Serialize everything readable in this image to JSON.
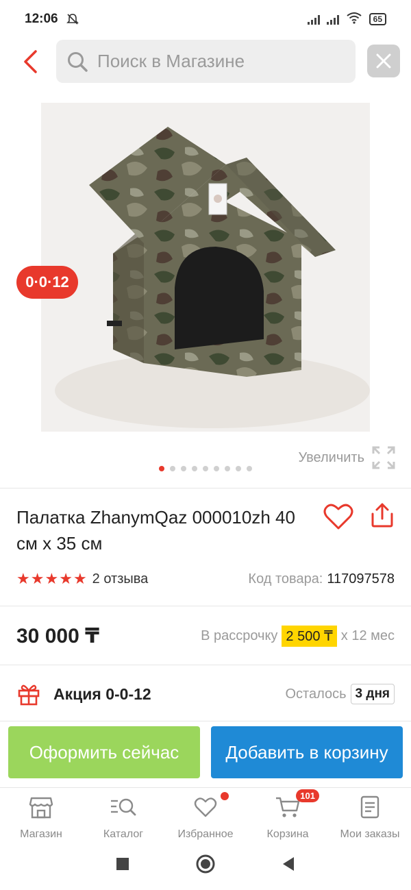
{
  "status_bar": {
    "time": "12:06",
    "battery": "65"
  },
  "search": {
    "placeholder": "Поиск в Магазине"
  },
  "gallery": {
    "promo_badge": "0·0·12",
    "zoom_label": "Увеличить",
    "dots_count": 9,
    "active_dot": 0
  },
  "product": {
    "title": "Палатка ZhanymQaz 000010zh 40 см х 35 см",
    "rating": 5,
    "reviews": "2 отзыва",
    "code_label": "Код товара:",
    "code_value": "117097578",
    "price": "30 000 ₸",
    "installment_label": "В рассрочку",
    "installment_amount": "2 500 ₸",
    "installment_term": "х 12 мес"
  },
  "promo": {
    "label": "Акция 0-0-12",
    "left_label": "Осталось",
    "days": "3 дня"
  },
  "actions": {
    "buy_now": "Оформить сейчас",
    "add_to_cart": "Добавить в корзину"
  },
  "bottom_nav": {
    "items": [
      {
        "label": "Магазин",
        "icon": "store-icon"
      },
      {
        "label": "Каталог",
        "icon": "catalog-icon"
      },
      {
        "label": "Избранное",
        "icon": "heart-icon"
      },
      {
        "label": "Корзина",
        "icon": "cart-icon",
        "badge": "101"
      },
      {
        "label": "Мои заказы",
        "icon": "orders-icon"
      }
    ]
  },
  "colors": {
    "accent": "#e8392c",
    "green": "#9bd65c",
    "blue": "#1f8ad6",
    "yellow": "#ffd500"
  }
}
